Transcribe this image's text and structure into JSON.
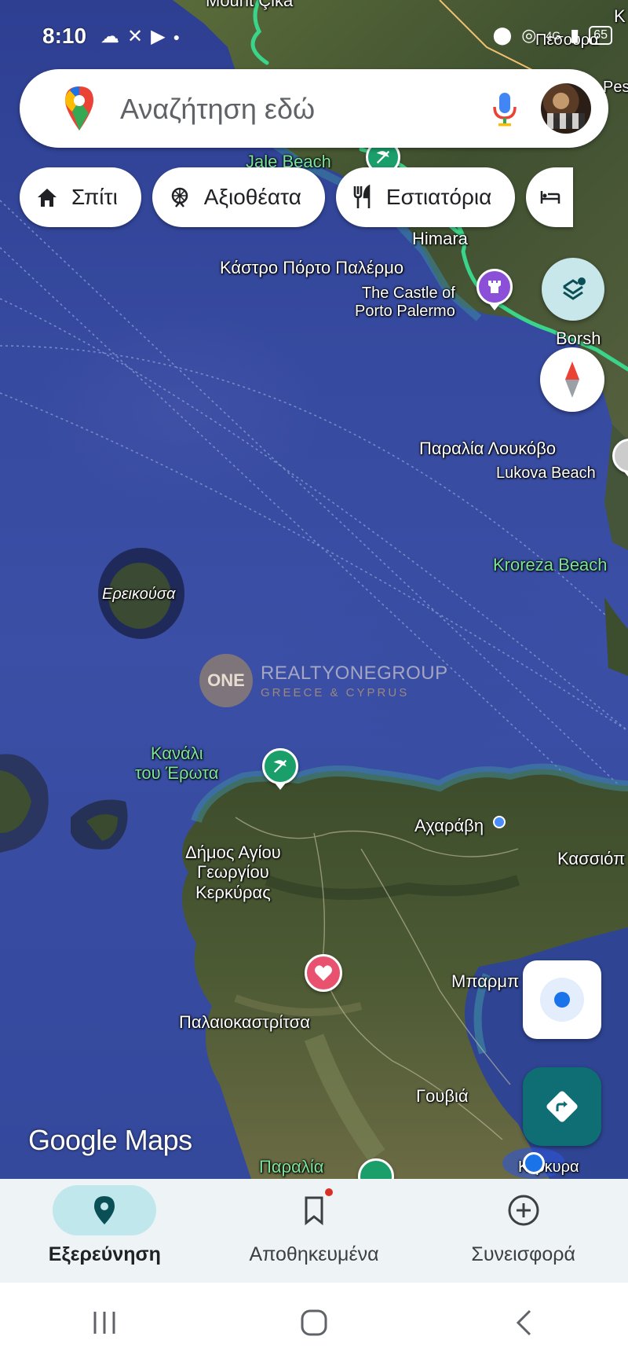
{
  "status_bar": {
    "time": "8:10",
    "left_icons": [
      "cloud-icon",
      "missed-call-icon",
      "youtube-icon",
      "dot-icon"
    ],
    "right_icons": [
      "location-icon",
      "hotspot-icon",
      "4g-icon",
      "signal-icon",
      "battery-icon"
    ],
    "battery_level": "65"
  },
  "search": {
    "placeholder": "Αναζήτηση εδώ"
  },
  "chips": [
    {
      "label": "Σπίτι",
      "icon": "home-icon"
    },
    {
      "label": "Αξιοθέατα",
      "icon": "attractions-icon"
    },
    {
      "label": "Εστιατόρια",
      "icon": "restaurant-icon"
    }
  ],
  "map_labels": {
    "mount_cika": "Mount Çika",
    "jale_beach": "Jale Beach",
    "himara": "Himara",
    "porto_palermo_gr": "Κάστρο Πόρτο Παλέρμο",
    "porto_palermo_en": "The Castle of\nPorto Palermo",
    "borsh": "Borsh",
    "lukova_gr": "Παραλία Λουκόβο",
    "lukova_en": "Lukova Beach",
    "kroreza": "Kroreza Beach",
    "ereikousa": "Ερεικούσα",
    "kanali": "Κανάλι\nτου Έρωτα",
    "acharavi": "Αχαράβη",
    "kassiopi": "Κασσιόπ",
    "dimos": "Δήμος Αγίου\nΓεωργίου\nΚερκύρας",
    "barbati": "Μπαρμπ",
    "palaiokastritsa": "Παλαιοκαστρίτσα",
    "gouvia": "Γουβιά",
    "paralia": "Παραλία",
    "kerkyra": "Κέρκυρα",
    "top_right_partial": "Κ",
    "top_right_partial2": "Πεσούρα",
    "top_right_partial3": "Pes"
  },
  "watermark": {
    "logo_text": "ONE",
    "line1": "REALTYONEGROUP",
    "line2": "GREECE & CYPRUS"
  },
  "branding": {
    "google_maps": "Google Maps"
  },
  "bottom_nav": [
    {
      "label": "Εξερεύνηση",
      "icon": "explore-pin-icon",
      "active": true
    },
    {
      "label": "Αποθηκευμένα",
      "icon": "bookmark-icon",
      "active": false,
      "badge": true
    },
    {
      "label": "Συνεισφορά",
      "icon": "add-circle-icon",
      "active": false
    }
  ],
  "colors": {
    "sea": "#34489c",
    "poi_green": "#1a9e6a",
    "poi_purple": "#8b4fd8",
    "poi_pink": "#e9526f",
    "route_green": "#3ad48a",
    "nav_active": "#bfe7ec",
    "directions": "#0f6e74"
  }
}
